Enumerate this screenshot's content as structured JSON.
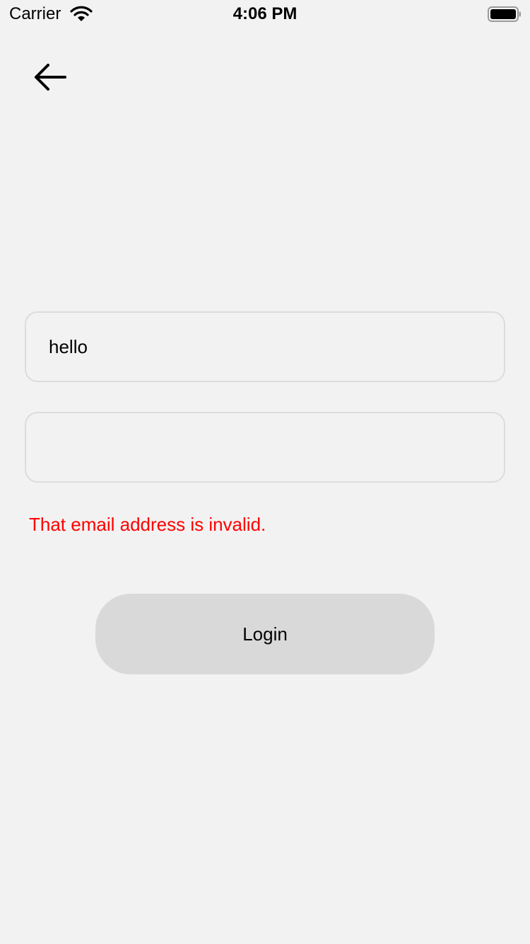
{
  "status_bar": {
    "carrier": "Carrier",
    "time": "4:06 PM",
    "wifi_icon": "wifi-icon",
    "battery_icon": "battery-icon"
  },
  "nav": {
    "back_icon": "arrow-left-icon"
  },
  "form": {
    "email_value": "hello",
    "email_placeholder": "",
    "password_value": "",
    "password_placeholder": "",
    "error_message": "That email address is invalid.",
    "login_label": "Login"
  },
  "colors": {
    "background": "#f2f2f2",
    "error": "#ff0000",
    "button_bg": "#d9d9d9",
    "field_border": "#dcdcdc"
  }
}
